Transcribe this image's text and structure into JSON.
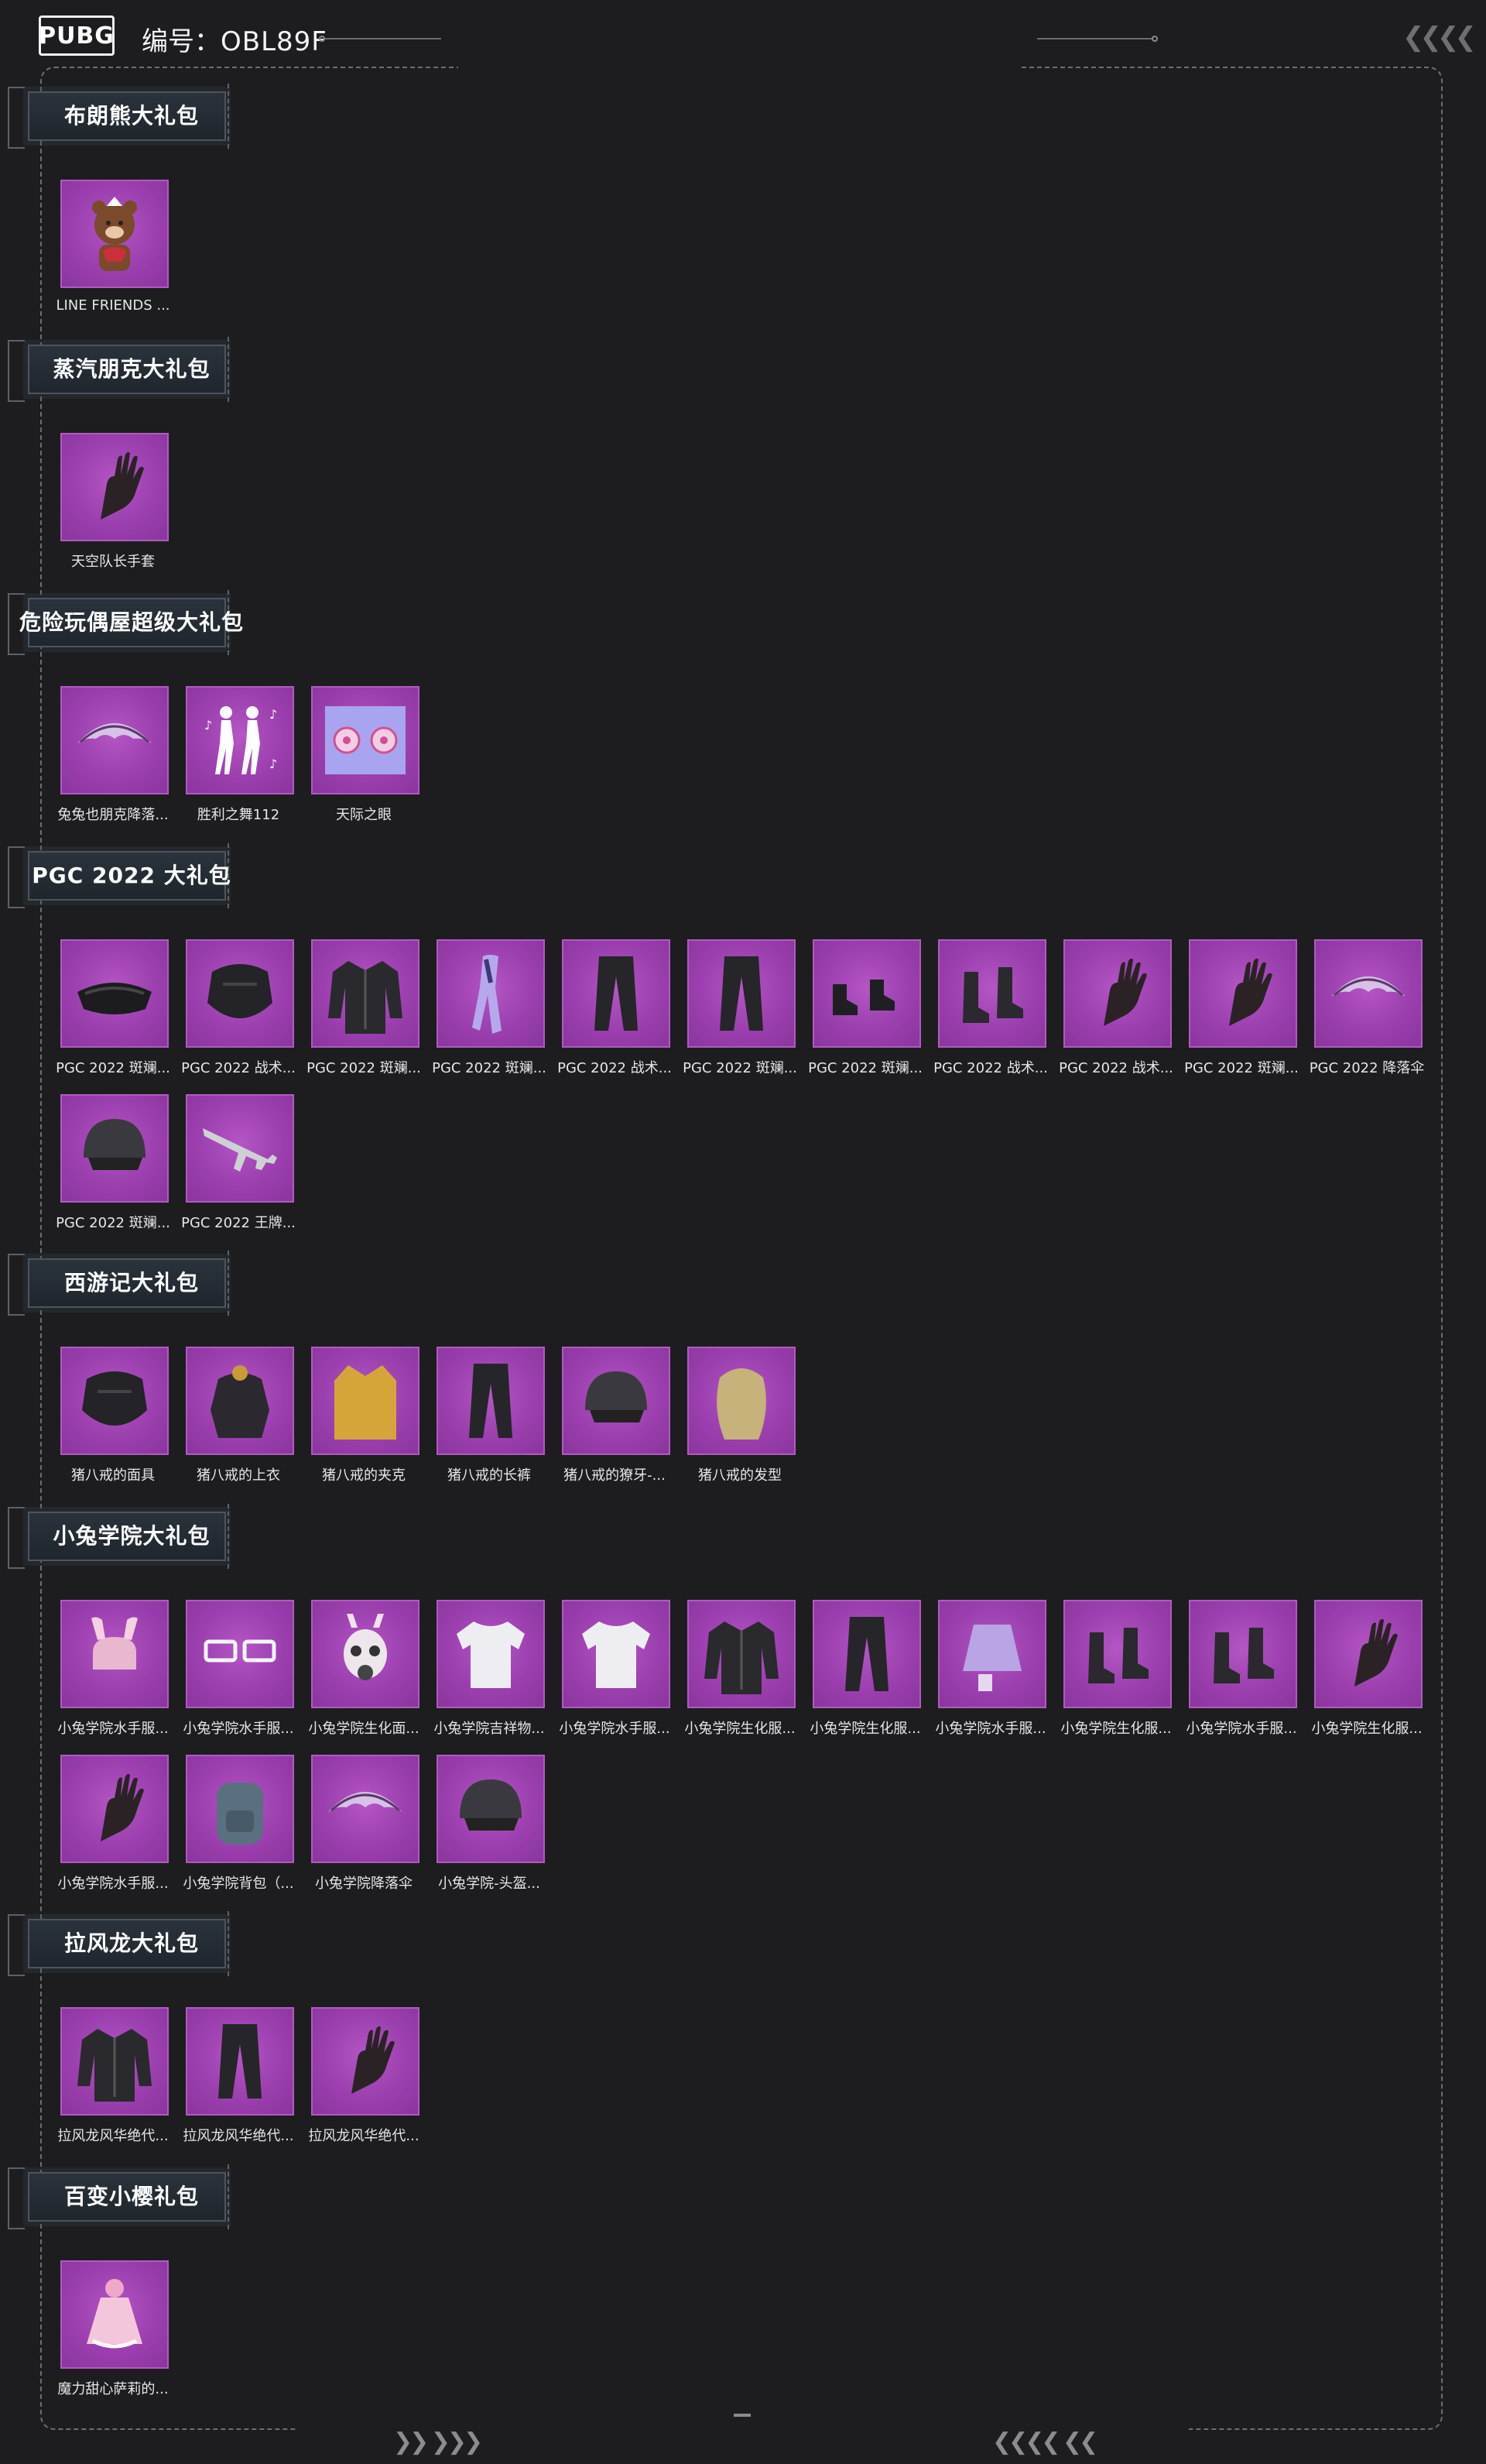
{
  "header": {
    "logo_text": "PUBG",
    "serial_label": "编号：",
    "serial_value": "OBL89F"
  },
  "sections": [
    {
      "title": "布朗熊大礼包",
      "items": [
        {
          "label": "LINE FRIENDS ...",
          "icon": "brown-bear-icon"
        }
      ]
    },
    {
      "title": "蒸汽朋克大礼包",
      "items": [
        {
          "label": "天空队长手套",
          "icon": "glove-icon"
        }
      ]
    },
    {
      "title": "危险玩偶屋超级大礼包",
      "items": [
        {
          "label": "兔兔也朋克降落...",
          "icon": "parachute-icon"
        },
        {
          "label": "胜利之舞112",
          "icon": "dance-emote-icon"
        },
        {
          "label": "天际之眼",
          "icon": "eyes-icon"
        }
      ]
    },
    {
      "title": "PGC 2022 大礼包",
      "items": [
        {
          "label": "PGC 2022 斑斓...",
          "icon": "goggles-icon"
        },
        {
          "label": "PGC 2022 战术...",
          "icon": "mask-icon"
        },
        {
          "label": "PGC 2022 斑斓...",
          "icon": "jacket-icon"
        },
        {
          "label": "PGC 2022 斑斓...",
          "icon": "scarf-icon"
        },
        {
          "label": "PGC 2022 战术...",
          "icon": "pants-icon"
        },
        {
          "label": "PGC 2022 斑斓...",
          "icon": "pants-icon"
        },
        {
          "label": "PGC 2022 斑斓...",
          "icon": "shoes-icon"
        },
        {
          "label": "PGC 2022 战术...",
          "icon": "boots-icon"
        },
        {
          "label": "PGC 2022 战术...",
          "icon": "glove-icon"
        },
        {
          "label": "PGC 2022 斑斓...",
          "icon": "glove-icon"
        },
        {
          "label": "PGC 2022 降落伞",
          "icon": "parachute-icon"
        },
        {
          "label": "PGC 2022 斑斓...",
          "icon": "helmet-icon"
        },
        {
          "label": "PGC 2022 王牌...",
          "icon": "rifle-icon"
        }
      ]
    },
    {
      "title": "西游记大礼包",
      "items": [
        {
          "label": "猪八戒的面具",
          "icon": "mask-icon"
        },
        {
          "label": "猪八戒的上衣",
          "icon": "armor-icon"
        },
        {
          "label": "猪八戒的夹克",
          "icon": "coat-icon"
        },
        {
          "label": "猪八戒的长裤",
          "icon": "pants-icon"
        },
        {
          "label": "猪八戒的獠牙-...",
          "icon": "helmet-icon"
        },
        {
          "label": "猪八戒的发型",
          "icon": "hair-icon"
        }
      ]
    },
    {
      "title": "小兔学院大礼包",
      "items": [
        {
          "label": "小兔学院水手服...",
          "icon": "bunny-hat-icon"
        },
        {
          "label": "小兔学院水手服...",
          "icon": "glasses-icon"
        },
        {
          "label": "小兔学院生化面...",
          "icon": "gas-mask-icon"
        },
        {
          "label": "小兔学院吉祥物...",
          "icon": "shirt-icon"
        },
        {
          "label": "小兔学院水手服...",
          "icon": "shirt-icon"
        },
        {
          "label": "小兔学院生化服...",
          "icon": "jacket-icon"
        },
        {
          "label": "小兔学院生化服...",
          "icon": "pants-icon"
        },
        {
          "label": "小兔学院水手服...",
          "icon": "skirt-icon"
        },
        {
          "label": "小兔学院生化服...",
          "icon": "boots-icon"
        },
        {
          "label": "小兔学院水手服...",
          "icon": "boots-icon"
        },
        {
          "label": "小兔学院生化服...",
          "icon": "glove-icon"
        },
        {
          "label": "小兔学院水手服...",
          "icon": "glove-icon"
        },
        {
          "label": "小兔学院背包（...",
          "icon": "backpack-icon"
        },
        {
          "label": "小兔学院降落伞",
          "icon": "parachute-icon"
        },
        {
          "label": "小兔学院-头盔...",
          "icon": "helmet-icon"
        }
      ]
    },
    {
      "title": "拉风龙大礼包",
      "items": [
        {
          "label": "拉风龙风华绝代...",
          "icon": "jacket-icon"
        },
        {
          "label": "拉风龙风华绝代...",
          "icon": "pants-icon"
        },
        {
          "label": "拉风龙风华绝代...",
          "icon": "glove-icon"
        }
      ]
    },
    {
      "title": "百变小樱礼包",
      "items": [
        {
          "label": "魔力甜心萨莉的...",
          "icon": "dress-icon"
        }
      ]
    }
  ],
  "colors": {
    "background": "#1d1d1f",
    "tile": "#9b3fae",
    "tile_border": "#b05ac0"
  }
}
